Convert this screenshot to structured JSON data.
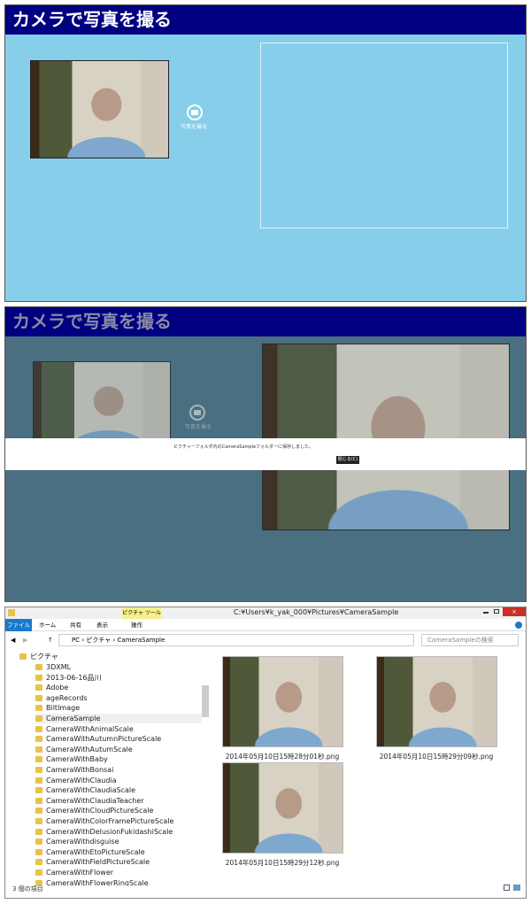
{
  "panel1": {
    "title": "カメラで写真を撮る",
    "capture_label": "写真を撮る",
    "capture_icon": "camera-icon"
  },
  "panel2": {
    "title": "カメラで写真を撮る",
    "capture_label": "写真を撮る",
    "message": "ピクチャーフォルダ内のCameraSampleフォルダーに保存しました。",
    "close_button": "閉じる(C)"
  },
  "explorer": {
    "title": "C:¥Users¥k_yak_000¥Pictures¥CameraSample",
    "context_tab": "ピクチャ ツール",
    "tabs": [
      "ファイル",
      "ホーム",
      "共有",
      "表示",
      "操作"
    ],
    "breadcrumb": [
      "PC",
      "ピクチャ",
      "CameraSample"
    ],
    "search_placeholder": "CameraSampleの検索",
    "tree_root": "ピクチャ",
    "tree": [
      "3DXML",
      "2013-06-16品川",
      "Adobe",
      "ageRecords",
      "BiltImage",
      "CameraSample",
      "CameraWithAnimalScale",
      "CameraWithAutumnPictureScale",
      "CameraWithAutumScale",
      "CameraWithBaby",
      "CameraWithBonsai",
      "CameraWithClaudia",
      "CameraWithClaudiaScale",
      "CameraWithClaudiaTeacher",
      "CameraWithCloudPictureScale",
      "CameraWithColorFramePictureScale",
      "CameraWithDelusionFukidashiScale",
      "CameraWithdisguise",
      "CameraWithEtoPictureScale",
      "CameraWithFieldPictureScale",
      "CameraWithFlower",
      "CameraWithFlowerRingScale"
    ],
    "selected": "CameraSample",
    "files": [
      "2014年05月10日15時28分01秒.png",
      "2014年05月10日15時29分09秒.png",
      "2014年05月10日15時29分12秒.png"
    ],
    "status": "3 個の項目",
    "colors": {
      "file_tab": "#1979ca",
      "context": "#f6f08a"
    }
  }
}
